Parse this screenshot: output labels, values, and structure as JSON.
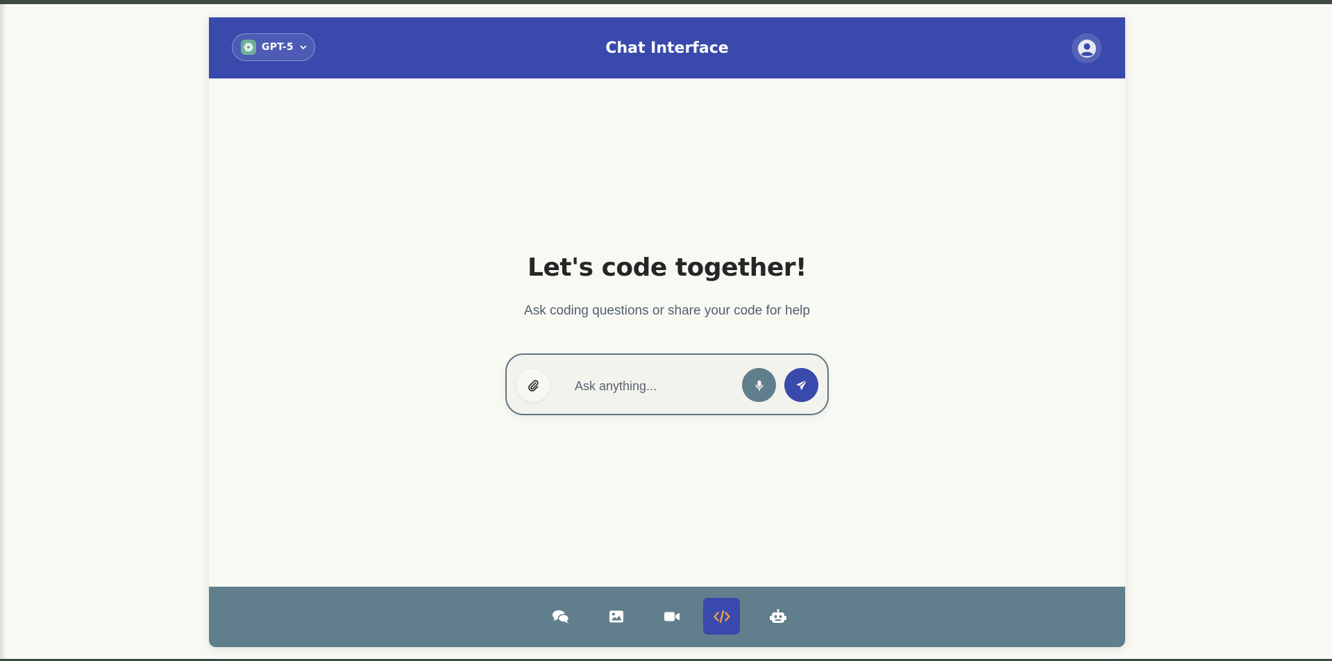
{
  "header": {
    "model_label": "GPT-5",
    "title": "Chat Interface",
    "model_icon": "openai-logo-icon",
    "avatar_icon": "user-circle-icon"
  },
  "hero": {
    "title": "Let's code together!",
    "subtitle": "Ask coding questions or share your code for help"
  },
  "input": {
    "placeholder": "Ask anything...",
    "value": ""
  },
  "nav": {
    "items": [
      {
        "name": "chat",
        "icon": "chat-bubbles-icon",
        "active": false
      },
      {
        "name": "image",
        "icon": "image-icon",
        "active": false
      },
      {
        "name": "video",
        "icon": "video-camera-icon",
        "active": false
      },
      {
        "name": "code",
        "icon": "code-icon",
        "active": true
      },
      {
        "name": "agent",
        "icon": "robot-icon",
        "active": false
      }
    ]
  },
  "colors": {
    "primary": "#3a49ac",
    "footer": "#617e8c",
    "accent_code": "#f0a040",
    "background": "#f9f9f4"
  }
}
